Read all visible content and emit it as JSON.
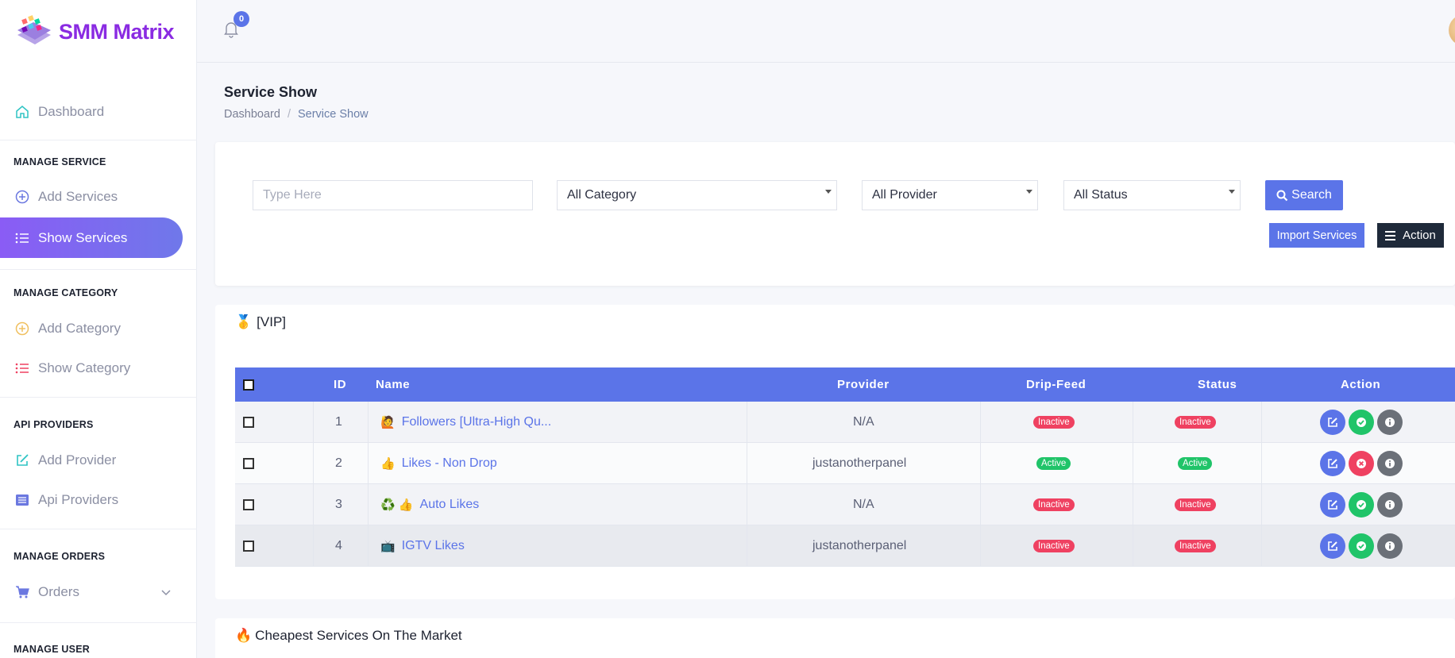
{
  "app": {
    "name": "SMM Matrix"
  },
  "topbar": {
    "notification_count": "0"
  },
  "sidebar": {
    "dashboard": "Dashboard",
    "sections": [
      {
        "title": "MANAGE SERVICE",
        "items": [
          "Add Services",
          "Show Services"
        ]
      },
      {
        "title": "MANAGE CATEGORY",
        "items": [
          "Add Category",
          "Show Category"
        ]
      },
      {
        "title": "API PROVIDERS",
        "items": [
          "Add Provider",
          "Api Providers"
        ]
      },
      {
        "title": "MANAGE ORDERS",
        "items": [
          "Orders"
        ]
      },
      {
        "title": "MANAGE USER",
        "items": []
      }
    ],
    "active_item": "Show Services"
  },
  "page": {
    "title": "Service Show",
    "breadcrumb": [
      "Dashboard",
      "Service Show"
    ]
  },
  "filters": {
    "search_placeholder": "Type Here",
    "category": "All Category",
    "provider": "All Provider",
    "status": "All Status",
    "search_label": "Search",
    "import_label": "Import Services",
    "action_label": "Action"
  },
  "table": {
    "category_title": "[VIP]",
    "category_emoji": "🥇",
    "headers": [
      "ID",
      "Name",
      "Provider",
      "Drip-Feed",
      "Status",
      "Action"
    ],
    "rows": [
      {
        "id": "1",
        "emoji": "🙋",
        "name": "Followers [Ultra-High Qu...",
        "provider": "N/A",
        "drip_feed": "Inactive",
        "status": "Inactive",
        "toggle": "activate"
      },
      {
        "id": "2",
        "emoji": "👍",
        "name": "Likes - Non Drop",
        "provider": "justanotherpanel",
        "drip_feed": "Active",
        "status": "Active",
        "toggle": "deactivate"
      },
      {
        "id": "3",
        "emoji": "♻️ 👍",
        "name": "Auto Likes",
        "provider": "N/A",
        "drip_feed": "Inactive",
        "status": "Inactive",
        "toggle": "activate"
      },
      {
        "id": "4",
        "emoji": "📺",
        "name": "IGTV Likes",
        "provider": "justanotherpanel",
        "drip_feed": "Inactive",
        "status": "Inactive",
        "toggle": "activate"
      }
    ]
  },
  "next_category": {
    "emoji": "🔥",
    "title": "Cheapest Services On The Market"
  },
  "colors": {
    "primary": "#5b74e8",
    "active": "#20c469",
    "inactive": "#ef4161",
    "dark": "#1f2a3a",
    "brand": "#8a2be2"
  }
}
